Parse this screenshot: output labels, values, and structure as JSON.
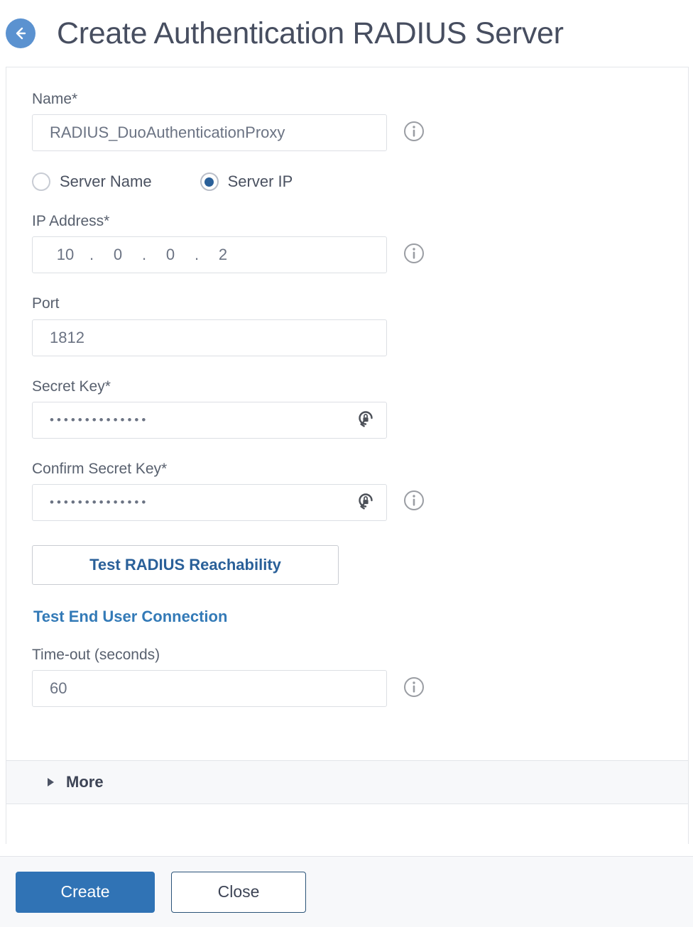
{
  "header": {
    "back_icon": "back-arrow-icon",
    "title": "Create Authentication RADIUS Server",
    "accent_blue": "#5b92d0",
    "title_color": "#474e60"
  },
  "form": {
    "name": {
      "label": "Name*",
      "value": "RADIUS_DuoAuthenticationProxy",
      "info_icon": "info-icon"
    },
    "server_mode": {
      "options": [
        {
          "label": "Server Name",
          "selected": false
        },
        {
          "label": "Server IP",
          "selected": true
        }
      ]
    },
    "ip_address": {
      "label": "IP Address*",
      "octets": [
        "10",
        "0",
        "0",
        "2"
      ],
      "separator": ".",
      "info_icon": "info-icon"
    },
    "port": {
      "label": "Port",
      "value": "1812"
    },
    "secret_key": {
      "label": "Secret Key*",
      "value": "••••••••••••••",
      "field_icon": "lock-reset-icon"
    },
    "confirm_secret_key": {
      "label": "Confirm Secret Key*",
      "value": "••••••••••••••",
      "field_icon": "lock-reset-icon",
      "info_icon": "info-icon"
    },
    "test_reachability_button": "Test RADIUS Reachability",
    "test_end_user_link": "Test End User Connection",
    "timeout": {
      "label": "Time-out (seconds)",
      "value": "60",
      "info_icon": "info-icon"
    }
  },
  "more_section": {
    "label": "More",
    "expanded": false,
    "caret_icon": "caret-right-icon"
  },
  "footer": {
    "create_label": "Create",
    "close_label": "Close",
    "primary_color": "#3073b5"
  }
}
